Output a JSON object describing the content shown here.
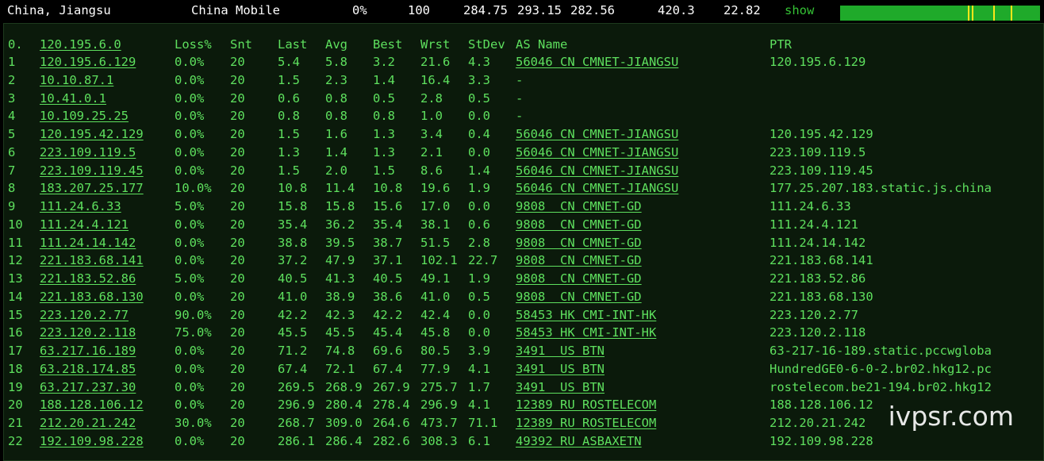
{
  "header": {
    "location": "China, Jiangsu",
    "isp": "China Mobile",
    "loss": "0%",
    "sent": "100",
    "last": "284.75",
    "avg": "293.15",
    "best": "282.56",
    "worst": "420.3",
    "stdev": "22.82",
    "show_label": "show"
  },
  "table": {
    "columns": [
      "0.",
      "120.195.6.0",
      "Loss%",
      "Snt",
      "Last",
      "Avg",
      "Best",
      "Wrst",
      "StDev",
      "AS Name",
      "PTR"
    ],
    "rows": [
      {
        "hop": "1",
        "host": "120.195.6.129",
        "loss": "0.0%",
        "snt": "20",
        "last": "5.4",
        "avg": "5.8",
        "best": "3.2",
        "wrst": "21.6",
        "stdev": "4.3",
        "as": "56046 CN CMNET-JIANGSU",
        "ptr": "120.195.6.129"
      },
      {
        "hop": "2",
        "host": "10.10.87.1",
        "loss": "0.0%",
        "snt": "20",
        "last": "1.5",
        "avg": "2.3",
        "best": "1.4",
        "wrst": "16.4",
        "stdev": "3.3",
        "as": "-",
        "ptr": ""
      },
      {
        "hop": "3",
        "host": "10.41.0.1",
        "loss": "0.0%",
        "snt": "20",
        "last": "0.6",
        "avg": "0.8",
        "best": "0.5",
        "wrst": "2.8",
        "stdev": "0.5",
        "as": "-",
        "ptr": ""
      },
      {
        "hop": "4",
        "host": "10.109.25.25",
        "loss": "0.0%",
        "snt": "20",
        "last": "0.8",
        "avg": "0.8",
        "best": "0.8",
        "wrst": "1.0",
        "stdev": "0.0",
        "as": "-",
        "ptr": ""
      },
      {
        "hop": "5",
        "host": "120.195.42.129",
        "loss": "0.0%",
        "snt": "20",
        "last": "1.5",
        "avg": "1.6",
        "best": "1.3",
        "wrst": "3.4",
        "stdev": "0.4",
        "as": "56046 CN CMNET-JIANGSU",
        "ptr": "120.195.42.129"
      },
      {
        "hop": "6",
        "host": "223.109.119.5",
        "loss": "0.0%",
        "snt": "20",
        "last": "1.3",
        "avg": "1.4",
        "best": "1.3",
        "wrst": "2.1",
        "stdev": "0.0",
        "as": "56046 CN CMNET-JIANGSU",
        "ptr": "223.109.119.5"
      },
      {
        "hop": "7",
        "host": "223.109.119.45",
        "loss": "0.0%",
        "snt": "20",
        "last": "1.5",
        "avg": "2.0",
        "best": "1.5",
        "wrst": "8.6",
        "stdev": "1.4",
        "as": "56046 CN CMNET-JIANGSU",
        "ptr": "223.109.119.45"
      },
      {
        "hop": "8",
        "host": "183.207.25.177",
        "loss": "10.0%",
        "snt": "20",
        "last": "10.8",
        "avg": "11.4",
        "best": "10.8",
        "wrst": "19.6",
        "stdev": "1.9",
        "as": "56046 CN CMNET-JIANGSU",
        "ptr": "177.25.207.183.static.js.china"
      },
      {
        "hop": "9",
        "host": "111.24.6.33",
        "loss": "5.0%",
        "snt": "20",
        "last": "15.8",
        "avg": "15.8",
        "best": "15.6",
        "wrst": "17.0",
        "stdev": "0.0",
        "as": "9808  CN CMNET-GD",
        "ptr": "111.24.6.33"
      },
      {
        "hop": "10",
        "host": "111.24.4.121",
        "loss": "0.0%",
        "snt": "20",
        "last": "35.4",
        "avg": "36.2",
        "best": "35.4",
        "wrst": "38.1",
        "stdev": "0.6",
        "as": "9808  CN CMNET-GD",
        "ptr": "111.24.4.121"
      },
      {
        "hop": "11",
        "host": "111.24.14.142",
        "loss": "0.0%",
        "snt": "20",
        "last": "38.8",
        "avg": "39.5",
        "best": "38.7",
        "wrst": "51.5",
        "stdev": "2.8",
        "as": "9808  CN CMNET-GD",
        "ptr": "111.24.14.142"
      },
      {
        "hop": "12",
        "host": "221.183.68.141",
        "loss": "0.0%",
        "snt": "20",
        "last": "37.2",
        "avg": "47.9",
        "best": "37.1",
        "wrst": "102.1",
        "stdev": "22.7",
        "as": "9808  CN CMNET-GD",
        "ptr": "221.183.68.141"
      },
      {
        "hop": "13",
        "host": "221.183.52.86",
        "loss": "5.0%",
        "snt": "20",
        "last": "40.5",
        "avg": "41.3",
        "best": "40.5",
        "wrst": "49.1",
        "stdev": "1.9",
        "as": "9808  CN CMNET-GD",
        "ptr": "221.183.52.86"
      },
      {
        "hop": "14",
        "host": "221.183.68.130",
        "loss": "0.0%",
        "snt": "20",
        "last": "41.0",
        "avg": "38.9",
        "best": "38.6",
        "wrst": "41.0",
        "stdev": "0.5",
        "as": "9808  CN CMNET-GD",
        "ptr": "221.183.68.130"
      },
      {
        "hop": "15",
        "host": "223.120.2.77",
        "loss": "90.0%",
        "snt": "20",
        "last": "42.2",
        "avg": "42.3",
        "best": "42.2",
        "wrst": "42.4",
        "stdev": "0.0",
        "as": "58453 HK CMI-INT-HK",
        "ptr": "223.120.2.77"
      },
      {
        "hop": "16",
        "host": "223.120.2.118",
        "loss": "75.0%",
        "snt": "20",
        "last": "45.5",
        "avg": "45.5",
        "best": "45.4",
        "wrst": "45.8",
        "stdev": "0.0",
        "as": "58453 HK CMI-INT-HK",
        "ptr": "223.120.2.118"
      },
      {
        "hop": "17",
        "host": "63.217.16.189",
        "loss": "0.0%",
        "snt": "20",
        "last": "71.2",
        "avg": "74.8",
        "best": "69.6",
        "wrst": "80.5",
        "stdev": "3.9",
        "as": "3491  US BTN",
        "ptr": "63-217-16-189.static.pccwgloba"
      },
      {
        "hop": "18",
        "host": "63.218.174.85",
        "loss": "0.0%",
        "snt": "20",
        "last": "67.4",
        "avg": "72.1",
        "best": "67.4",
        "wrst": "77.9",
        "stdev": "4.1",
        "as": "3491  US BTN",
        "ptr": "HundredGE0-6-0-2.br02.hkg12.pc"
      },
      {
        "hop": "19",
        "host": "63.217.237.30",
        "loss": "0.0%",
        "snt": "20",
        "last": "269.5",
        "avg": "268.9",
        "best": "267.9",
        "wrst": "275.7",
        "stdev": "1.7",
        "as": "3491  US BTN",
        "ptr": "rostelecom.be21-194.br02.hkg12"
      },
      {
        "hop": "20",
        "host": "188.128.106.12",
        "loss": "0.0%",
        "snt": "20",
        "last": "296.9",
        "avg": "280.4",
        "best": "278.4",
        "wrst": "296.9",
        "stdev": "4.1",
        "as": "12389 RU ROSTELECOM",
        "ptr": "188.128.106.12"
      },
      {
        "hop": "21",
        "host": "212.20.21.242",
        "loss": "30.0%",
        "snt": "20",
        "last": "268.7",
        "avg": "309.0",
        "best": "264.6",
        "wrst": "473.7",
        "stdev": "71.1",
        "as": "12389 RU ROSTELECOM",
        "ptr": "212.20.21.242"
      },
      {
        "hop": "22",
        "host": "192.109.98.228",
        "loss": "0.0%",
        "snt": "20",
        "last": "286.1",
        "avg": "286.4",
        "best": "282.6",
        "wrst": "308.3",
        "stdev": "6.1",
        "as": "49392 RU ASBAXETN",
        "ptr": "192.109.98.228"
      }
    ]
  },
  "watermark": "ivpsr.com",
  "colors": {
    "text_green": "#5ee05e",
    "background": "#0b1a0b",
    "bar_green": "#1faa2a",
    "bar_tick": "#ffe61a"
  }
}
